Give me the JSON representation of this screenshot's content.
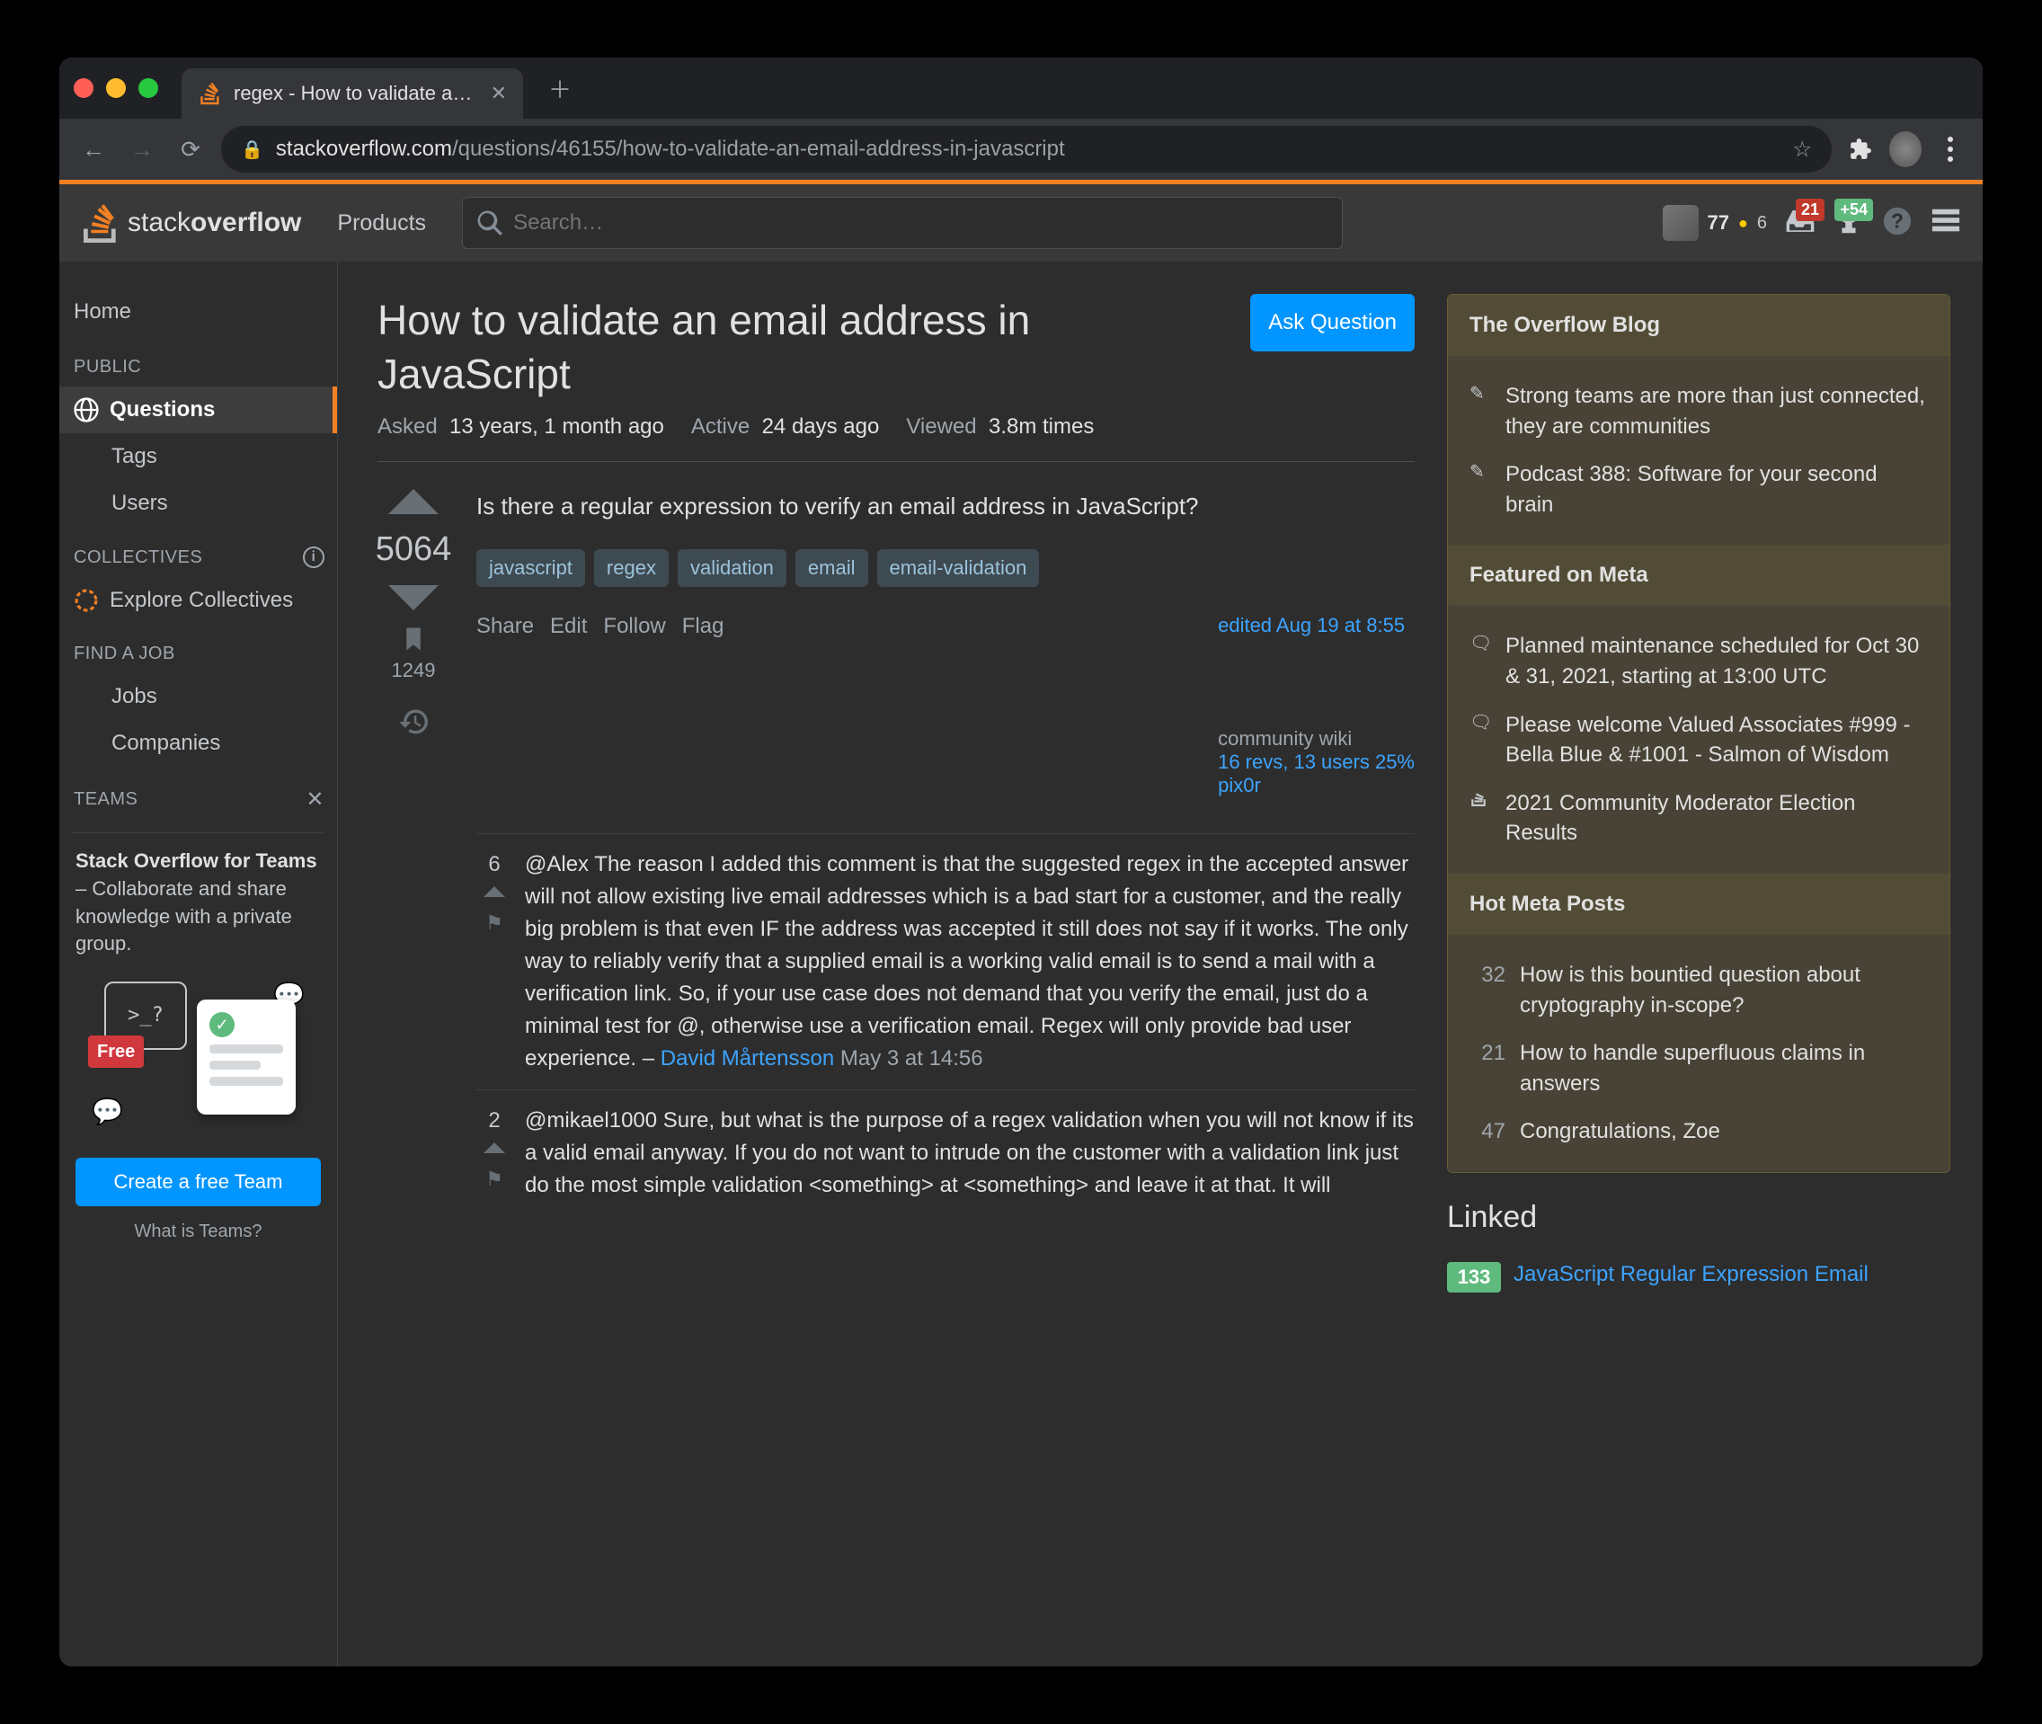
{
  "browser": {
    "tab_title": "regex - How to validate an ema",
    "url_host": "stackoverflow.com",
    "url_path": "/questions/46155/how-to-validate-an-email-address-in-javascript"
  },
  "topbar": {
    "logo_thin": "stack",
    "logo_bold": "overflow",
    "products": "Products",
    "search_placeholder": "Search…",
    "rep": "77",
    "gold_count": "6",
    "inbox_badge": "21",
    "achievements_badge": "+54"
  },
  "sidebar": {
    "home": "Home",
    "public": "PUBLIC",
    "questions": "Questions",
    "tags": "Tags",
    "users": "Users",
    "collectives": "COLLECTIVES",
    "explore_collectives": "Explore Collectives",
    "find_job": "FIND A JOB",
    "jobs": "Jobs",
    "companies": "Companies",
    "teams": "TEAMS",
    "teams_card_bold": "Stack Overflow for Teams",
    "teams_card_text": " – Collaborate and share knowledge with a private group.",
    "teams_free": "Free",
    "teams_prompt": ">_?",
    "create_team": "Create a free Team",
    "what_is_teams": "What is Teams?"
  },
  "question": {
    "title": "How to validate an email address in JavaScript",
    "ask_button": "Ask Question",
    "stats": {
      "asked_label": "Asked",
      "asked_value": "13 years, 1 month ago",
      "active_label": "Active",
      "active_value": "24 days ago",
      "viewed_label": "Viewed",
      "viewed_value": "3.8m times"
    },
    "score": "5064",
    "bookmark_count": "1249",
    "body": "Is there a regular expression to verify an email address in JavaScript?",
    "tags": [
      "javascript",
      "regex",
      "validation",
      "email",
      "email-validation"
    ],
    "actions": {
      "share": "Share",
      "edit": "Edit",
      "follow": "Follow",
      "flag": "Flag"
    },
    "signature": {
      "edited": "edited Aug 19 at 8:55",
      "wiki": "community wiki",
      "revs": "16 revs, 13 users 25%",
      "author": "pix0r"
    }
  },
  "comments": [
    {
      "score": "6",
      "text": "@Alex The reason I added this comment is that the suggested regex in the accepted answer will not allow existing live email addresses which is a bad start for a customer, and the really big problem is that even IF the address was accepted it still does not say if it works. The only way to reliably verify that a supplied email is a working valid email is to send a mail with a verification link. So, if your use case does not demand that you verify the email, just do a minimal test for @, otherwise use a verification email. Regex will only provide bad user experience. – ",
      "author": "David Mårtensson",
      "date": "May 3 at 14:56"
    },
    {
      "score": "2",
      "text": "@mikael1000 Sure, but what is the purpose of a regex validation when you will not know if its a valid email anyway. If you do not want to intrude on the customer with a validation link just do the most simple validation <something> at <something> and leave it at that. It will ",
      "author": "",
      "date": ""
    }
  ],
  "right": {
    "overflow_blog_header": "The Overflow Blog",
    "overflow_blog": [
      "Strong teams are more than just connected, they are communities",
      "Podcast 388: Software for your second brain"
    ],
    "featured_header": "Featured on Meta",
    "featured": [
      "Planned maintenance scheduled for Oct 30 & 31, 2021, starting at 13:00 UTC",
      "Please welcome Valued Associates #999 - Bella Blue & #1001 - Salmon of Wisdom",
      "2021 Community Moderator Election Results"
    ],
    "hot_header": "Hot Meta Posts",
    "hot": [
      {
        "n": "32",
        "t": "How is this bountied question about cryptography in-scope?"
      },
      {
        "n": "21",
        "t": "How to handle superfluous claims in answers"
      },
      {
        "n": "47",
        "t": "Congratulations, Zoe"
      }
    ],
    "linked_header": "Linked",
    "linked": [
      {
        "n": "133",
        "t": "JavaScript Regular Expression Email "
      }
    ]
  }
}
